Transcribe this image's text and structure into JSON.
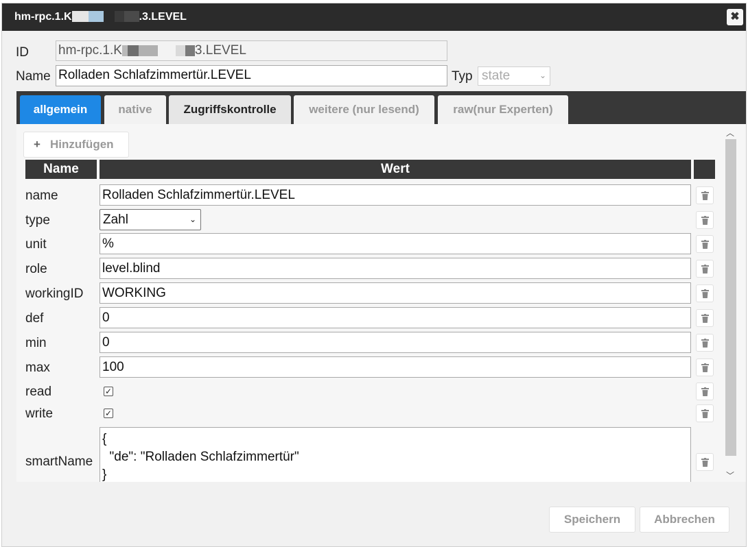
{
  "dialog": {
    "title_prefix": "hm-rpc.1.K",
    "title_suffix": ".3.LEVEL",
    "close_icon": "close-icon"
  },
  "header": {
    "id_label": "ID",
    "id_value_prefix": "hm-rpc.1.K",
    "id_value_suffix": "3.LEVEL",
    "name_label": "Name",
    "name_value": "Rolladen Schlafzimmertür.LEVEL",
    "typ_label": "Typ",
    "typ_value": "state"
  },
  "tabs": [
    {
      "label": "allgemein",
      "active": true
    },
    {
      "label": "native"
    },
    {
      "label": "Zugriffskontrolle"
    },
    {
      "label": "weitere (nur lesend)"
    },
    {
      "label": "raw(nur Experten)"
    }
  ],
  "toolbar": {
    "add_icon": "+",
    "add_label": "Hinzufügen"
  },
  "table": {
    "headers": [
      "Name",
      "Wert",
      ""
    ],
    "rows": [
      {
        "name": "name",
        "value": "Rolladen Schlafzimmertür.LEVEL",
        "kind": "text"
      },
      {
        "name": "type",
        "value": "Zahl",
        "kind": "select"
      },
      {
        "name": "unit",
        "value": "%",
        "kind": "text"
      },
      {
        "name": "role",
        "value": "level.blind",
        "kind": "text"
      },
      {
        "name": "workingID",
        "value": "WORKING",
        "kind": "text"
      },
      {
        "name": "def",
        "value": "0",
        "kind": "text"
      },
      {
        "name": "min",
        "value": "0",
        "kind": "text"
      },
      {
        "name": "max",
        "value": "100",
        "kind": "text"
      },
      {
        "name": "read",
        "value": "true",
        "kind": "checkbox"
      },
      {
        "name": "write",
        "value": "true",
        "kind": "checkbox"
      },
      {
        "name": "smartName",
        "value": "{\n  \"de\": \"Rolladen Schlafzimmertür\"\n}",
        "kind": "textarea"
      }
    ]
  },
  "footer": {
    "save_label": "Speichern",
    "cancel_label": "Abbrechen"
  },
  "colors": {
    "accent": "#1e88e5",
    "titlebar": "#2b2b2b",
    "tabbar": "#383838"
  }
}
